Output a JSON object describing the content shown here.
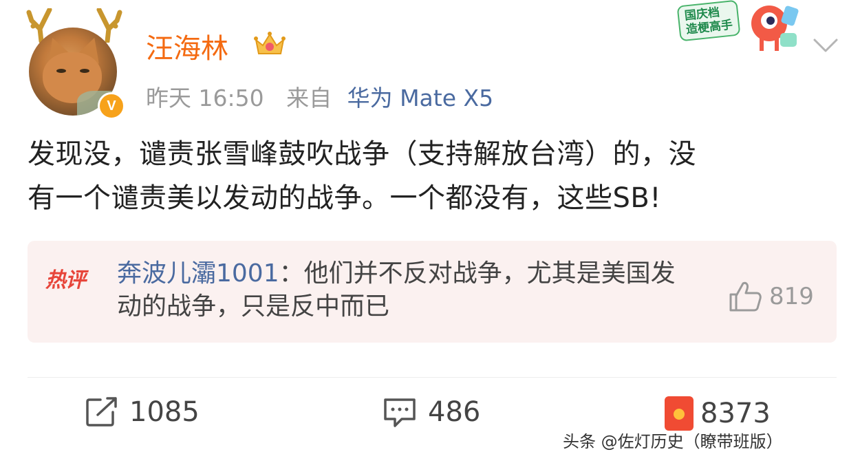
{
  "header": {
    "username": "汪海林",
    "time": "昨天 16:50",
    "from_label": "来自",
    "device": "华为 Mate X5",
    "verified_badge": "V",
    "icons": [
      "antler-icon",
      "crown-icon",
      "chevron-down-icon"
    ]
  },
  "promo": {
    "tag_line1": "国庆档",
    "tag_line2": "造梗高手"
  },
  "post": {
    "text": "发现没，谴责张雪峰鼓吹战争（支持解放台湾）的，没\n有一个谴责美以发动的战争。一个都没有，这些SB!"
  },
  "hot_comment": {
    "label": "热评",
    "user": "奔波儿灞1001",
    "separator": "：",
    "text": "他们并不反对战争，尤其是美国发动的战争，只是反中而已",
    "likes": "819"
  },
  "actions": {
    "repost": "1085",
    "comment": "486",
    "like": "8373"
  },
  "watermark": "头条 @佐灯历史（瞭带班版）",
  "colors": {
    "username": "#f46a11",
    "link": "#4a6aa0",
    "hot_label": "#e7453a",
    "hot_bg": "#fbf1f0"
  }
}
